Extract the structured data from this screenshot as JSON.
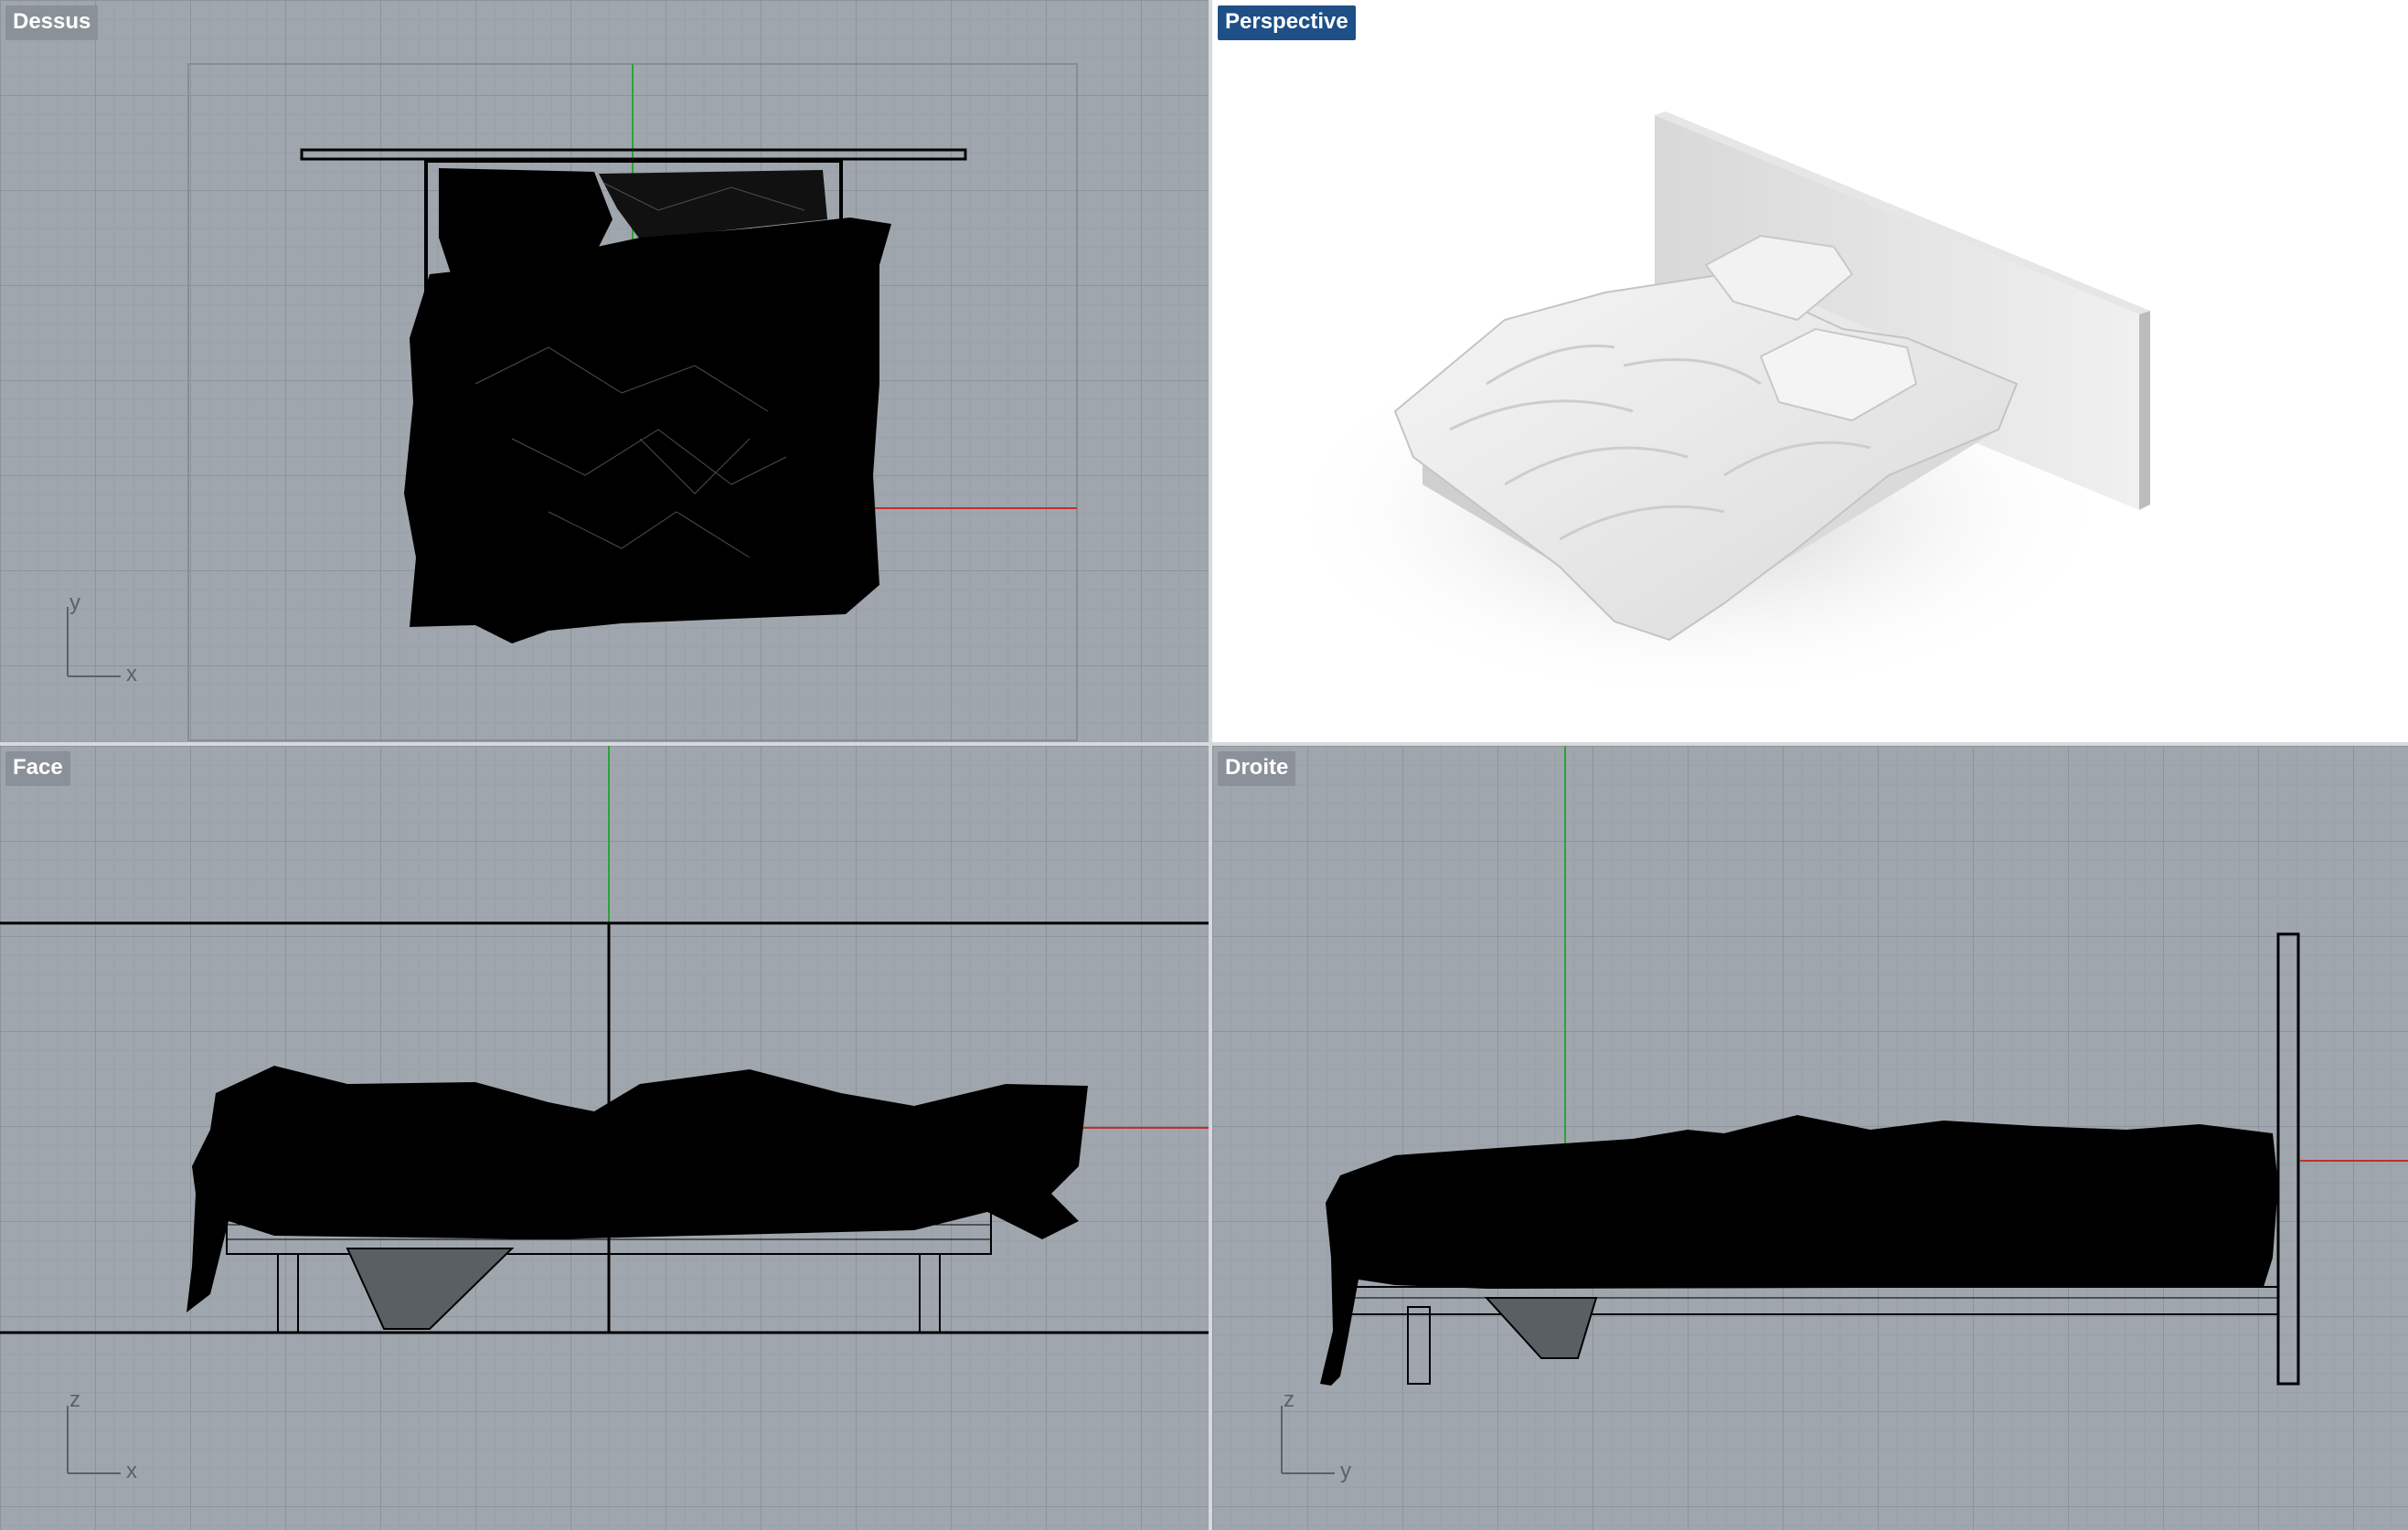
{
  "viewports": {
    "top": {
      "label": "Dessus",
      "axis_h": "x",
      "axis_v": "y",
      "active": false
    },
    "perspective": {
      "label": "Perspective",
      "active": true
    },
    "front": {
      "label": "Face",
      "axis_h": "x",
      "axis_v": "z",
      "active": false
    },
    "right": {
      "label": "Droite",
      "axis_h": "y",
      "axis_v": "z",
      "active": false
    }
  },
  "colors": {
    "viewport_background": "#a0a6ad",
    "grid_minor": "#98a0a7",
    "grid_major": "#8c939a",
    "x_axis": "#c0302e",
    "y_axis": "#2ea236",
    "label_inactive": "#8a9198",
    "label_active": "#1e4f86",
    "geometry": "#000000",
    "render_background": "#ffffff"
  },
  "scene": {
    "object": "bed-with-headboard-and-crumpled-sheets"
  }
}
